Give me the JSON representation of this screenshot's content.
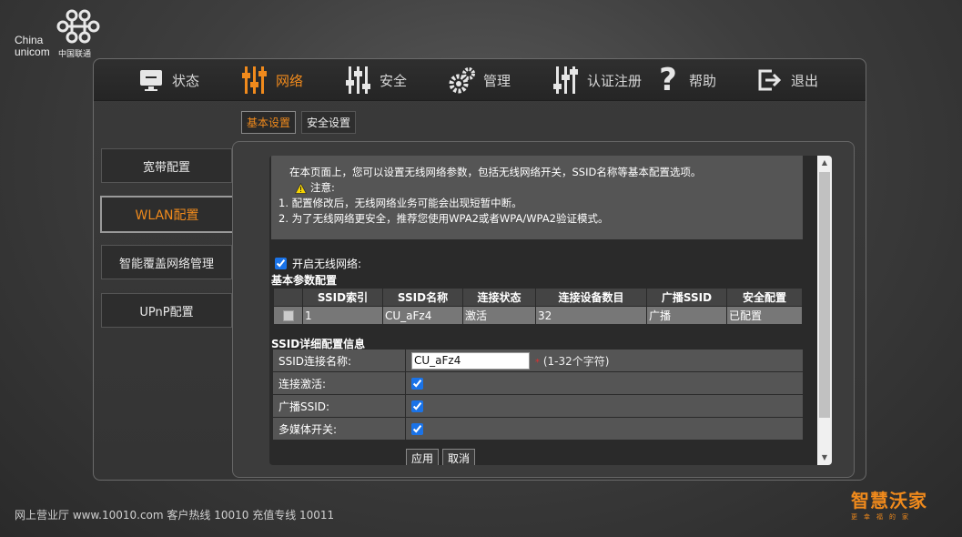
{
  "brand": {
    "name_en": "China\nunicom",
    "name_cn": "中国联通"
  },
  "nav": {
    "items": [
      {
        "label": "状态",
        "icon": "monitor-icon"
      },
      {
        "label": "网络",
        "icon": "network-sliders-icon",
        "active": true
      },
      {
        "label": "安全",
        "icon": "security-sliders-icon"
      },
      {
        "label": "管理",
        "icon": "gears-icon"
      },
      {
        "label": "认证注册",
        "icon": "register-sliders-icon"
      },
      {
        "label": "帮助",
        "icon": "question-icon"
      },
      {
        "label": "退出",
        "icon": "logout-icon"
      }
    ]
  },
  "subtabs": [
    {
      "label": "基本设置",
      "active": true
    },
    {
      "label": "安全设置"
    }
  ],
  "sidebar": {
    "items": [
      {
        "label": "宽带配置"
      },
      {
        "label": "WLAN配置",
        "active": true
      },
      {
        "label": "智能覆盖网络管理"
      },
      {
        "label": "UPnP配置"
      }
    ]
  },
  "info": {
    "description": "在本页面上，您可以设置无线网络参数，包括无线网络开关，SSID名称等基本配置选项。",
    "notice_label": "注意:",
    "notes": [
      "1. 配置修改后，无线网络业务可能会出现短暂中断。",
      "2. 为了无线网络更安全，推荐您使用WPA2或者WPA/WPA2验证模式。"
    ]
  },
  "wlan_enable": {
    "label": "开启无线网络:",
    "checked": true
  },
  "basic_params": {
    "title": "基本参数配置",
    "columns": [
      "",
      "SSID索引",
      "SSID名称",
      "连接状态",
      "连接设备数目",
      "广播SSID",
      "安全配置"
    ],
    "rows": [
      {
        "index": "1",
        "name": "CU_aFz4",
        "status": "激活",
        "devices": "32",
        "broadcast": "广播",
        "security": "已配置"
      }
    ]
  },
  "ssid_detail": {
    "title": "SSID详细配置信息",
    "ssid_name_label": "SSID连接名称:",
    "ssid_name_value": "CU_aFz4",
    "ssid_name_hint": "(1-32个字符)",
    "required_mark": "*",
    "active_label": "连接激活:",
    "broadcast_label": "广播SSID:",
    "multimedia_label": "多媒体开关:"
  },
  "buttons": {
    "apply": "应用",
    "cancel": "取消"
  },
  "footer": {
    "text": "网上营业厅 www.10010.com   客户热线 10010   充值专线 10011"
  },
  "slogan": {
    "main": "智慧沃家",
    "sub": "更幸福的家"
  },
  "colors": {
    "accent": "#f08a1c",
    "background": "#3e3e3e"
  }
}
